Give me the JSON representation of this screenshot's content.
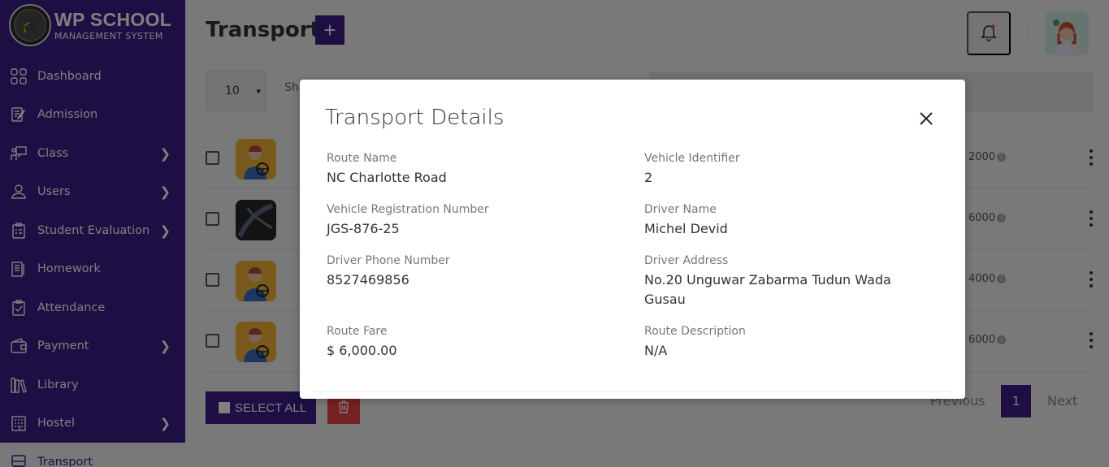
{
  "brand": {
    "title": "WP SCHOOL",
    "subtitle": "MANAGEMENT SYSTEM"
  },
  "sidebar": {
    "items": [
      {
        "label": "Dashboard",
        "icon": "dashboard-icon",
        "has_submenu": false
      },
      {
        "label": "Admission",
        "icon": "admission-icon",
        "has_submenu": false
      },
      {
        "label": "Class",
        "icon": "class-icon",
        "has_submenu": true
      },
      {
        "label": "Users",
        "icon": "user-icon",
        "has_submenu": true
      },
      {
        "label": "Student Evaluation",
        "icon": "evaluation-icon",
        "has_submenu": true
      },
      {
        "label": "Homework",
        "icon": "homework-icon",
        "has_submenu": false
      },
      {
        "label": "Attendance",
        "icon": "attendance-icon",
        "has_submenu": false
      },
      {
        "label": "Payment",
        "icon": "wallet-icon",
        "has_submenu": true
      },
      {
        "label": "Library",
        "icon": "library-icon",
        "has_submenu": false
      },
      {
        "label": "Hostel",
        "icon": "hostel-icon",
        "has_submenu": true
      },
      {
        "label": "Transport",
        "icon": "bus-icon",
        "has_submenu": false
      }
    ]
  },
  "header": {
    "title": "Transport",
    "add_label": "+"
  },
  "table": {
    "entries_value": "10",
    "show_text": "Sh",
    "rows": [
      {
        "fare": "2000",
        "image": "driver-avatar"
      },
      {
        "fare": "6000",
        "image": "vehicle-photo"
      },
      {
        "fare": "4000",
        "image": "driver-avatar"
      },
      {
        "fare": "6000",
        "image": "driver-avatar"
      }
    ]
  },
  "footer": {
    "select_all": "SELECT ALL",
    "previous": "Previous",
    "page": "1",
    "next": "Next"
  },
  "modal": {
    "title": "Transport Details",
    "fields": {
      "route_name": {
        "label": "Route Name",
        "value": "NC Charlotte Road"
      },
      "vehicle_identifier": {
        "label": "Vehicle Identifier",
        "value": "2"
      },
      "vehicle_registration": {
        "label": "Vehicle Registration Number",
        "value": "JGS-876-25"
      },
      "driver_name": {
        "label": "Driver Name",
        "value": "Michel Devid"
      },
      "driver_phone": {
        "label": "Driver Phone Number",
        "value": "8527469856"
      },
      "driver_address": {
        "label": "Driver Address",
        "value": "No.20 Unguwar Zabarma Tudun Wada Gusau"
      },
      "route_fare": {
        "label": "Route Fare",
        "value": "$ 6,000.00"
      },
      "route_description": {
        "label": "Route Description",
        "value": "N/A"
      }
    }
  },
  "colors": {
    "primary": "#3b1e88",
    "danger": "#e44444"
  }
}
